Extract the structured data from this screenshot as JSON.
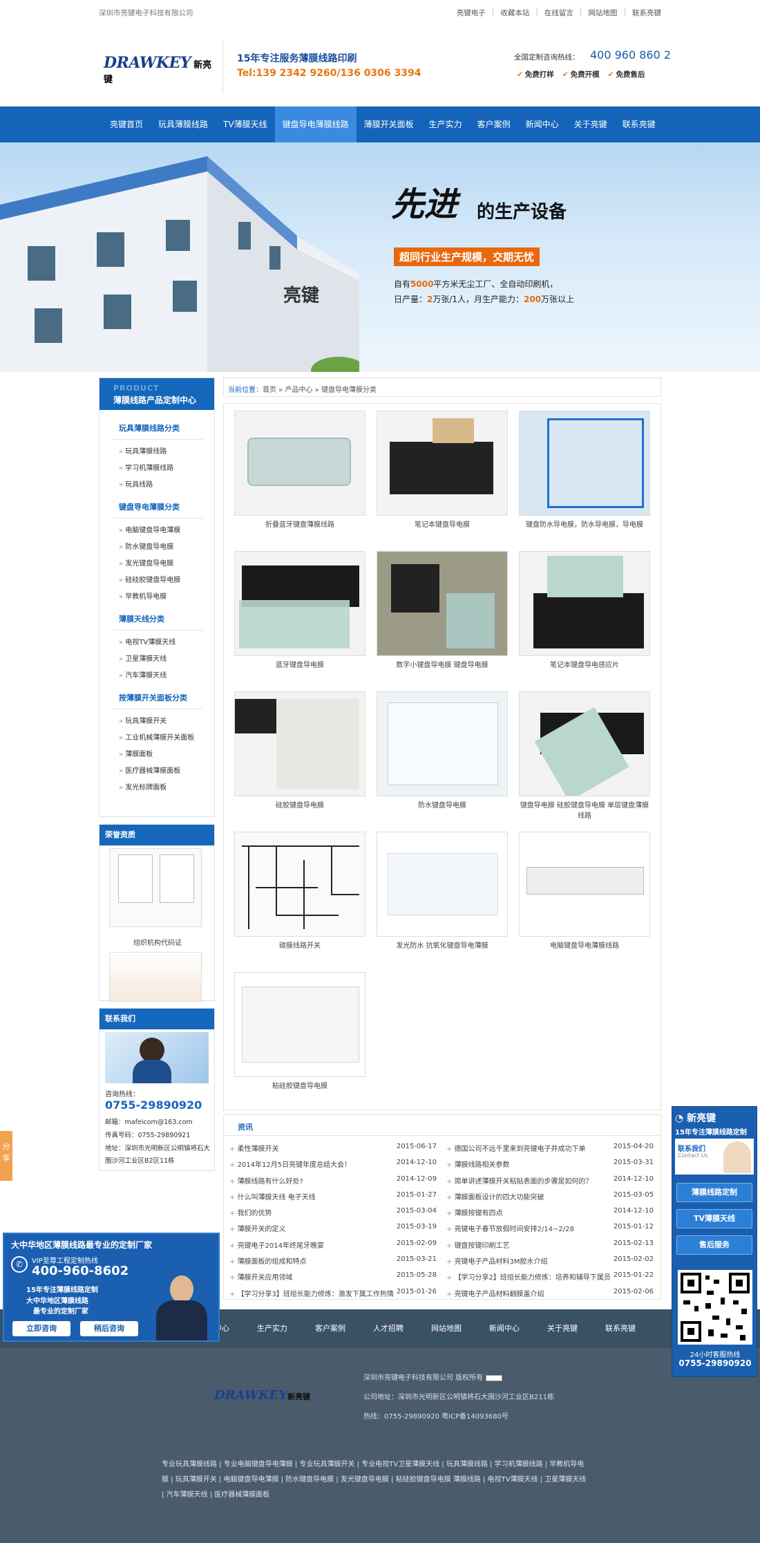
{
  "topbar": {
    "company": "深圳市亮键电子科技有限公司",
    "links": [
      "亮键电子",
      "收藏本站",
      "在线留言",
      "网站地图",
      "联系亮键"
    ]
  },
  "header": {
    "logo_en": "DRAWKEY",
    "logo_cn": "新亮键",
    "slogan": "15年专注服务薄膜线路印刷",
    "tel": "Tel:139 2342 9260/136 0306 3394",
    "hotline_label": "全国定制咨询热线：",
    "hotline": "400 960 860 2",
    "free": [
      "免费打样",
      "免费开模",
      "免费售后"
    ]
  },
  "nav": [
    "亮键首页",
    "玩具薄膜线路",
    "TV薄膜天线",
    "键盘导电薄膜线路",
    "薄膜开关面板",
    "生产实力",
    "客户案例",
    "新闻中心",
    "关于亮键",
    "联系亮键"
  ],
  "nav_active": 3,
  "banner": {
    "title1": "先进",
    "title2": "的生产设备",
    "tag": "超同行业生产规模，交期无忧",
    "line1_a": "自有",
    "line1_b": "5000",
    "line1_c": "平方米无尘工厂、全自动印刷机，",
    "line2_a": "日产量：",
    "line2_b": "2",
    "line2_c": "万张/1人，月生产能力：",
    "line2_d": "200",
    "line2_e": "万张以上",
    "building_sign": "亮键"
  },
  "sidebar": {
    "head_en": "PRODUCT",
    "head_cn": "薄膜线路产品定制中心",
    "groups": [
      {
        "title": "玩具薄膜线路分类",
        "items": [
          "玩具薄膜线路",
          "学习机薄膜线路",
          "玩具线路"
        ]
      },
      {
        "title": "键盘导电薄膜分类",
        "items": [
          "电脑键盘导电薄膜",
          "防水键盘导电膜",
          "发光键盘导电膜",
          "硅硅胶键盘导电膜",
          "早教机导电膜"
        ]
      },
      {
        "title": "薄膜天线分类",
        "items": [
          "电视TV薄膜天线",
          "卫星薄膜天线",
          "汽车薄膜天线"
        ]
      },
      {
        "title": "按薄膜开关面板分类",
        "items": [
          "玩具薄膜开关",
          "工业机械薄膜开关面板",
          "薄膜面板",
          "医疗器械薄膜面板",
          "发光标牌面板"
        ]
      }
    ],
    "honor_title": "荣誉资质",
    "honor_caption": "组织机构代码证",
    "contact_title": "联系我们",
    "consult_label": "咨询热线：",
    "consult_phone": "0755-29890920",
    "email": "邮箱：mafeicom@163.com",
    "fax": "传真号码：0755-29890921",
    "address": "地址：深圳市光明新区公明镇将石大围沙河工业区B2区11栋"
  },
  "breadcrumb": {
    "here": "当前位置：",
    "path": "首页 » 产品中心 » 键盘导电薄膜分类"
  },
  "products": [
    "折叠蓝牙键盘薄膜线路",
    "笔记本键盘导电膜",
    "键盘防水导电膜，防水导电膜，导电膜",
    "蓝牙键盘导电膜",
    "数字小键盘导电膜 键盘导电膜",
    "笔记本键盘导电感应片",
    "硅胶键盘导电膜",
    "防水键盘导电膜",
    "键盘导电膜 硅胶键盘导电膜 单层键盘薄膜线路",
    "碳膜线路开关",
    "发光防水 抗氧化键盘导电薄膜",
    "电脑键盘导电薄膜线路",
    "粘硅胶键盘导电膜"
  ],
  "news": {
    "title": "资讯",
    "left": [
      [
        "柔性薄膜开关",
        "2015-06-17"
      ],
      [
        "2014年12月5日亮键年度总结大会！",
        "2014-12-10"
      ],
      [
        "薄膜线路有什么好处?",
        "2014-12-09"
      ],
      [
        "什么叫薄膜天线 电子天线",
        "2015-01-27"
      ],
      [
        "我们的优势",
        "2015-03-04"
      ],
      [
        "薄膜开关的定义",
        "2015-03-19"
      ],
      [
        "亮键电子2014年终尾牙晚宴",
        "2015-02-09"
      ],
      [
        "薄膜面板的组成和特点",
        "2015-03-21"
      ],
      [
        "薄膜开关应用领域",
        "2015-05-28"
      ],
      [
        "【学习分享3】班组长能力修炼：激发下属工作热情",
        "2015-01-26"
      ]
    ],
    "right": [
      [
        "德国公司不远千里来到亮键电子并成功下单",
        "2015-04-20"
      ],
      [
        "薄膜线路相关参数",
        "2015-03-31"
      ],
      [
        "简单讲述薄膜开关粘贴表面的步骤是如何的？",
        "2014-12-10"
      ],
      [
        "薄膜面板设计的四大功能突破",
        "2015-03-05"
      ],
      [
        "薄膜按键有四点",
        "2014-12-10"
      ],
      [
        "亮键电子春节放假时间安排2/14~2/28",
        "2015-01-12"
      ],
      [
        "键盘按键印刷工艺",
        "2015-02-13"
      ],
      [
        "亮键电子产品材料3M胶水介绍",
        "2015-02-02"
      ],
      [
        "【学习分享2】班组长能力修炼：培养和辅导下属员",
        "2015-01-22"
      ],
      [
        "亮键电子产品材料翻膜盖介绍",
        "2015-02-06"
      ]
    ]
  },
  "footer_nav": [
    "中心",
    "生产实力",
    "客户案例",
    "人才招聘",
    "网站地图",
    "新闻中心",
    "关于亮键",
    "联系亮键"
  ],
  "footer": {
    "copyright": "深圳市亮键电子科技有限公司 版权所有",
    "address": "公司地址：深圳市光明新区公明镇将石大围沙河工业区B211栋",
    "hotline": "热线：0755-29890920 粤ICP备14093680号",
    "links": "专业玩具薄膜线路 | 专业电脑键盘导电薄膜 | 专业玩具薄膜开关 | 专业电视TV卫星薄膜天线 | 玩具薄膜线路 | 学习机薄膜线路 | 早教机导电膜 | 玩具薄膜开关 | 电脑键盘导电薄膜 | 防水键盘导电膜 | 发光键盘导电膜 | 粘硅胶键盘导电膜 薄膜线路 | 电视TV薄膜天线 | 卫星薄膜天线 | 汽车薄膜天线 | 医疗器械薄膜面板"
  },
  "share": "分享",
  "left_ad": {
    "title": "大中华地区薄膜线路最专业的定制厂家",
    "vip": "VIP至尊工程定制热线",
    "phone": "400-960-8602",
    "b1": "15年专注薄膜线路定制",
    "b2": "大中华地区薄膜线路",
    "b3": "最专业的定制厂家",
    "btn1": "立即咨询",
    "btn2": "稍后咨询"
  },
  "right_float": {
    "brand": "新亮键",
    "sub": "15年专注薄膜线路定制",
    "contact": "联系我们",
    "contact_en": "Contact Us",
    "btn1": "薄膜线路定制",
    "btn2": "TV薄膜天线",
    "btn3": "售后服务",
    "h1": "24小时客服热线",
    "h2": "0755-29890920"
  }
}
